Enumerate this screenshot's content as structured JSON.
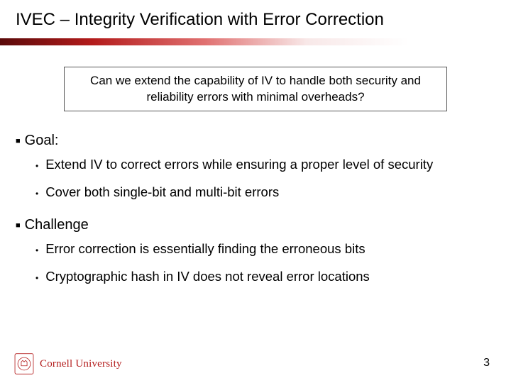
{
  "title": "IVEC – Integrity Verification with Error Correction",
  "question": "Can we extend the capability of IV to handle both security and reliability errors with minimal overheads?",
  "sections": [
    {
      "heading": "Goal:",
      "items": [
        "Extend IV to correct errors while ensuring a proper level of security",
        "Cover both single-bit and multi-bit errors"
      ]
    },
    {
      "heading": "Challenge",
      "items": [
        "Error correction is essentially finding the erroneous bits",
        "Cryptographic hash in IV does not reveal error locations"
      ]
    }
  ],
  "brand": {
    "wordmark": "Cornell University",
    "accent": "#b31b1b"
  },
  "page_number": "3"
}
